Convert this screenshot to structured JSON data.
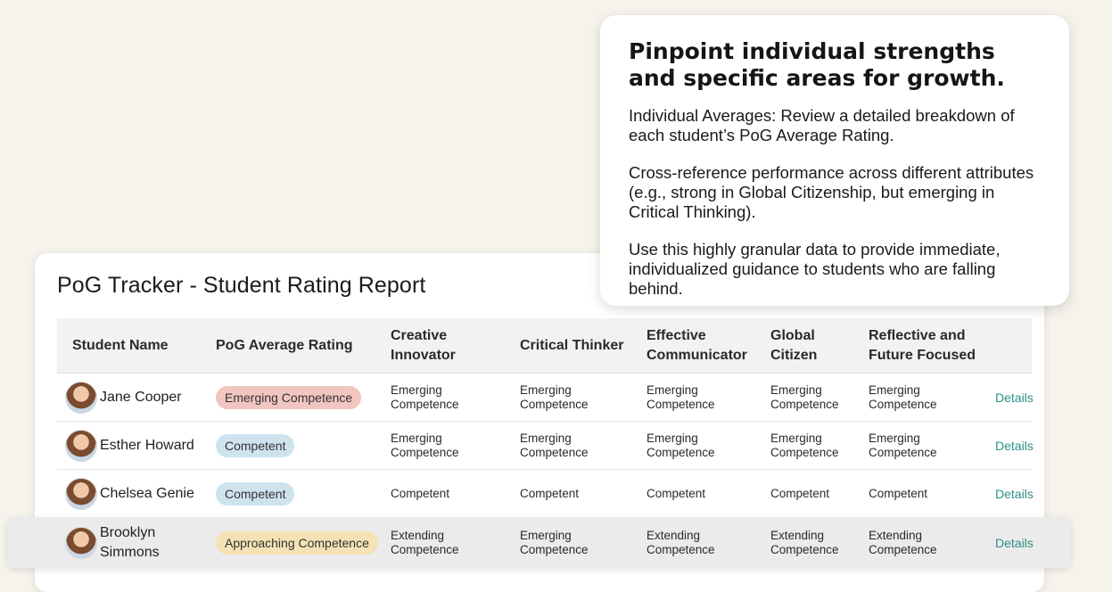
{
  "report": {
    "title": "PoG Tracker - Student Rating Report",
    "columns": [
      "Student Name",
      "PoG Average Rating",
      "Creative\nInnovator",
      "Critical Thinker",
      "Effective\nCommunicator",
      "Global\nCitizen",
      "Reflective and\nFuture Focused"
    ],
    "rows": [
      {
        "name": "Jane Cooper",
        "avg": "Emerging Competence",
        "creative": "Emerging\nCompetence",
        "critical": "Emerging\nCompetence",
        "effective": "Emerging\nCompetence",
        "global": "Emerging\nCompetence",
        "reflective": "Emerging\nCompetence",
        "details": "Details"
      },
      {
        "name": "Esther Howard",
        "avg": "Competent",
        "creative": "Emerging\nCompetence",
        "critical": "Emerging\nCompetence",
        "effective": "Emerging\nCompetence",
        "global": "Emerging\nCompetence",
        "reflective": "Emerging\nCompetence",
        "details": "Details"
      },
      {
        "name": "Chelsea Genie",
        "avg": "Competent",
        "creative": "Competent",
        "critical": "Competent",
        "effective": "Competent",
        "global": "Competent",
        "reflective": "Competent",
        "details": "Details"
      },
      {
        "name": "Brooklyn\nSimmons",
        "avg": "Approaching Competence",
        "creative": "Extending\nCompetence",
        "critical": "Emerging\nCompetence",
        "effective": "Extending\nCompetence",
        "global": "Extending\nCompetence",
        "reflective": "Extending\nCompetence",
        "details": "Details"
      }
    ]
  },
  "callout": {
    "title": "Pinpoint individual strengths and specific areas for growth.",
    "paragraphs": [
      "Individual Averages: Review a detailed breakdown of each student’s PoG Average Rating.",
      "Cross-reference performance across different attributes (e.g., strong in Global Citizenship, but emerging in Critical Thinking).",
      "Use this highly granular data to provide immediate, individualized guidance to students who are falling behind."
    ]
  },
  "colors": {
    "badge_emerging": "#f1c5c0",
    "badge_competent": "#cfe3ef",
    "badge_approaching": "#f4e2b4",
    "link": "#2f8f86",
    "background": "#f6f3ec"
  }
}
